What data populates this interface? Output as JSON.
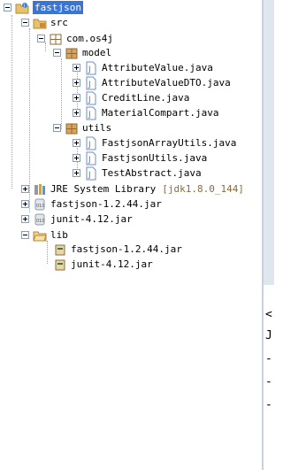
{
  "tree": {
    "project": "fastjson",
    "src": "src",
    "package_root": "com.os4j",
    "model": {
      "label": "model",
      "files": [
        "AttributeValue.java",
        "AttributeValueDTO.java",
        "CreditLine.java",
        "MaterialCompart.java"
      ]
    },
    "utils": {
      "label": "utils",
      "files": [
        "FastjsonArrayUtils.java",
        "FastjsonUtils.java",
        "TestAbstract.java"
      ]
    },
    "jre": {
      "label": "JRE System Library",
      "decoration": "[jdk1.8.0_144]"
    },
    "jars": [
      "fastjson-1.2.44.jar",
      "junit-4.12.jar"
    ],
    "lib": {
      "label": "lib",
      "files": [
        "fastjson-1.2.44.jar",
        "junit-4.12.jar"
      ]
    }
  },
  "right_pane": {
    "glyphs": [
      "<",
      "J",
      "-",
      "-",
      "-"
    ]
  },
  "colors": {
    "selection": "#3875d7",
    "jar_icon": "#8e9aa8",
    "package_icon": "#d9a35b",
    "java_icon": "#4a7ec2"
  }
}
